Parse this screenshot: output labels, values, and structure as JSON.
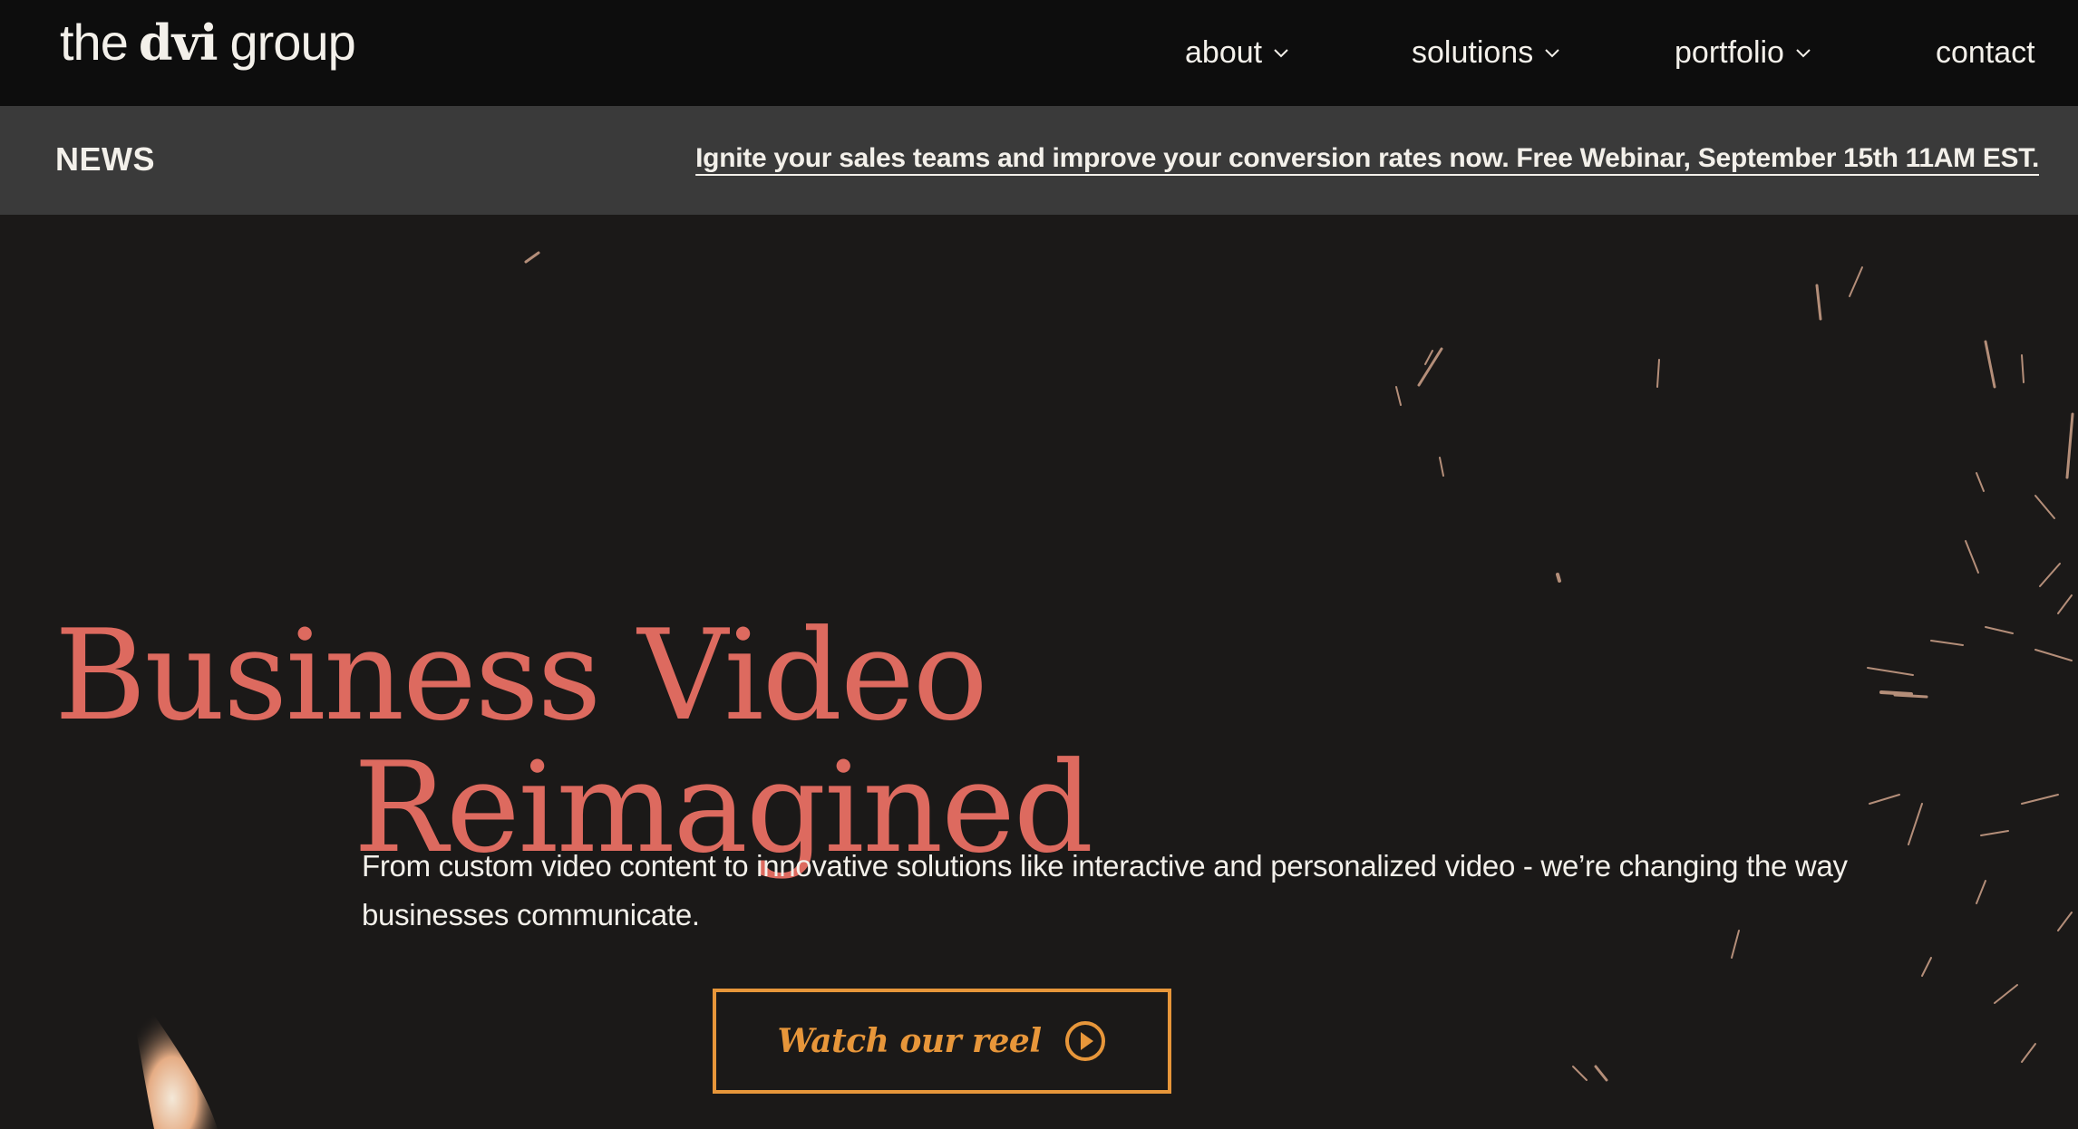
{
  "logo": {
    "part1": "the",
    "part2": "dvi",
    "part3": "group"
  },
  "nav": {
    "items": [
      {
        "label": "about",
        "has_dropdown": true
      },
      {
        "label": "solutions",
        "has_dropdown": true
      },
      {
        "label": "portfolio",
        "has_dropdown": true
      },
      {
        "label": "contact",
        "has_dropdown": false
      }
    ]
  },
  "news": {
    "label": "NEWS",
    "link_text": "Ignite your sales teams and improve your conversion rates now. Free Webinar, September 15th 11AM EST."
  },
  "hero": {
    "headline_line1": "Business Video",
    "headline_line2": "Reimagined",
    "subtext": "From custom video content to innovative solutions like interactive and personalized video - we’re changing the way businesses communicate.",
    "cta_label": "Watch our reel"
  },
  "colors": {
    "topbar_bg": "#0d0d0d",
    "newsbar_bg": "#3a3a3a",
    "hero_bg": "#1b1918",
    "headline": "#dd6a5f",
    "accent": "#e7963a",
    "text": "#f3f0ea"
  },
  "icons": {
    "nav_dropdown": "chevron-down-icon",
    "cta": "play-circle-icon"
  }
}
